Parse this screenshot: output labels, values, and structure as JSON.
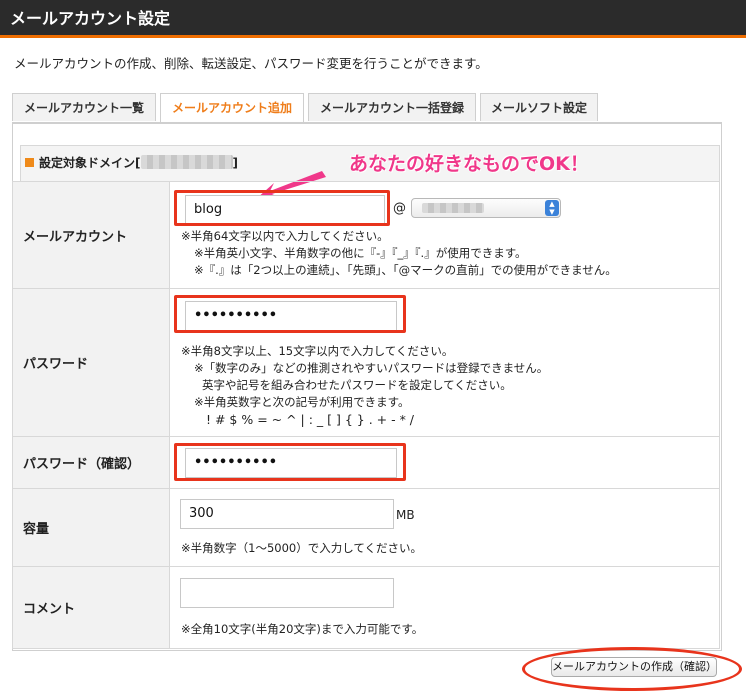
{
  "page_title": "メールアカウント設定",
  "description": "メールアカウントの作成、削除、転送設定、パスワード変更を行うことができます。",
  "tabs": [
    {
      "label": "メールアカウント一覧"
    },
    {
      "label": "メールアカウント追加"
    },
    {
      "label": "メールアカウント一括登録"
    },
    {
      "label": "メールソフト設定"
    }
  ],
  "domain_bar": {
    "label_prefix": "設定対象ドメイン[",
    "label_suffix": "]"
  },
  "annotation": "あなたの好きなものでOK！",
  "colors": {
    "accent": "#ef7d1a",
    "highlight": "#e8341c",
    "annotation": "#f0388a"
  },
  "form": {
    "account": {
      "label": "メールアカウント",
      "value": "blog",
      "at": "@",
      "notes": [
        "※半角64文字以内で入力してください。",
        "※半角英小文字、半角数字の他に『-』『_』『.』が使用できます。",
        "※『.』は「2つ以上の連続」、「先頭」、「@マークの直前」での使用ができません。"
      ]
    },
    "password": {
      "label": "パスワード",
      "value": "••••••••••",
      "notes": [
        "※半角8文字以上、15文字以内で入力してください。",
        "※「数字のみ」などの推測されやすいパスワードは登録できません。",
        "英字や記号を組み合わせたパスワードを設定してください。",
        "※半角英数字と次の記号が利用できます。",
        "! # $ % = ~ ^ | : _ [ ] { } . + - * /"
      ]
    },
    "password_confirm": {
      "label": "パスワード（確認）",
      "value": "••••••••••"
    },
    "capacity": {
      "label": "容量",
      "value": "300",
      "unit": "MB",
      "note": "※半角数字（1〜5000）で入力してください。"
    },
    "comment": {
      "label": "コメント",
      "value": "",
      "note": "※全角10文字(半角20文字)まで入力可能です。"
    }
  },
  "submit_label": "メールアカウントの作成（確認）"
}
